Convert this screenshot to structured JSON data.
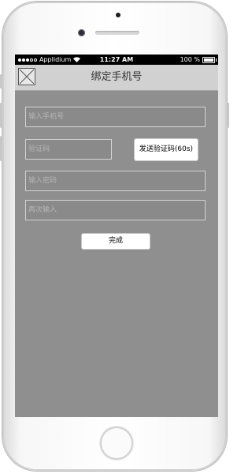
{
  "statusbar": {
    "carrier": "Applidium",
    "time": "11:27 AM",
    "battery_text": "100 %",
    "battery_level": 1.0
  },
  "navbar": {
    "title": "绑定手机号",
    "back_icon": "broken-image-icon"
  },
  "form": {
    "phone_placeholder": "输入手机号",
    "code_placeholder": "验证码",
    "send_code_label": "发送验证码(60s)",
    "password_placeholder": "输入密码",
    "confirm_placeholder": "再次输入",
    "done_label": "完成"
  },
  "colors": {
    "screen_bg": "#8f8f8f",
    "navbar_bg": "#d1d1d1",
    "field_border": "#d3d3d3"
  }
}
